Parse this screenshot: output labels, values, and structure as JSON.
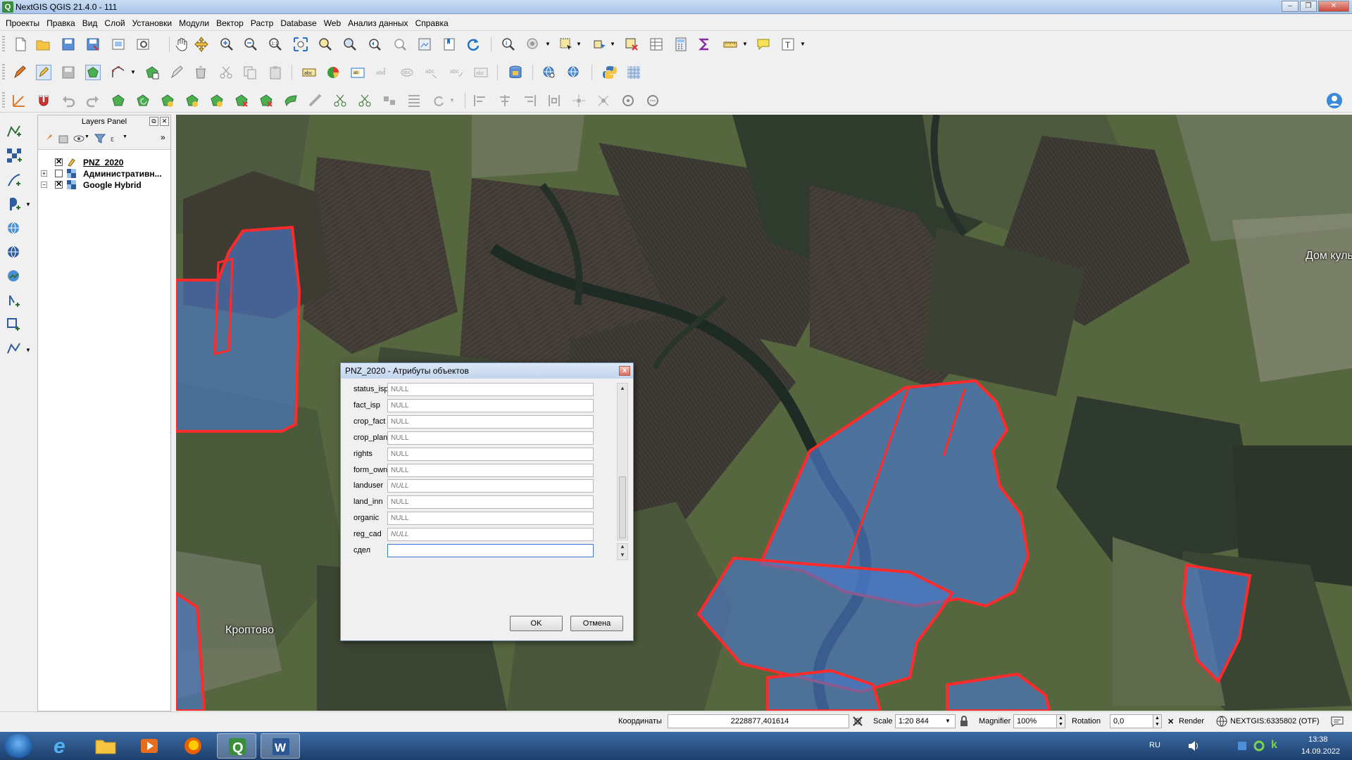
{
  "window": {
    "title": "NextGIS QGIS 21.4.0 - 111",
    "app_icon_letter": "Q"
  },
  "menu": [
    "Проекты",
    "Правка",
    "Вид",
    "Слой",
    "Установки",
    "Модули",
    "Вектор",
    "Растр",
    "Database",
    "Web",
    "Анализ данных",
    "Справка"
  ],
  "layers_panel": {
    "title": "Layers Panel",
    "layers": [
      {
        "name": "PNZ_2020",
        "checked": true
      },
      {
        "name": "Административн...",
        "checked": false
      },
      {
        "name": "Google Hybrid",
        "checked": true
      }
    ]
  },
  "map": {
    "labels": [
      "Кроптово",
      "Дом куль"
    ]
  },
  "dialog": {
    "title": "PNZ_2020 - Атрибуты объектов",
    "close_glyph": "x",
    "fields": [
      {
        "label": "status_isp",
        "placeholder": "NULL"
      },
      {
        "label": "fact_isp",
        "placeholder": "NULL"
      },
      {
        "label": "crop_fact",
        "placeholder": "NULL"
      },
      {
        "label": "crop_plan",
        "placeholder": "NULL"
      },
      {
        "label": "rights",
        "placeholder": "NULL"
      },
      {
        "label": "form_own",
        "placeholder": "NULL"
      },
      {
        "label": "landuser",
        "placeholder": "NULL"
      },
      {
        "label": "land_inn",
        "placeholder": "NULL"
      },
      {
        "label": "organic",
        "placeholder": "NULL"
      },
      {
        "label": "reg_cad",
        "placeholder": "NULL"
      },
      {
        "label": "сдел",
        "placeholder": ""
      }
    ],
    "ok_label": "OK",
    "cancel_label": "Отмена"
  },
  "statusbar": {
    "coord_label": "Координаты",
    "coord_value": "2228877,401614",
    "scale_label": "Scale",
    "scale_value": "1:20 844",
    "magnifier_label": "Magnifier",
    "magnifier_value": "100%",
    "rotation_label": "Rotation",
    "rotation_value": "0,0",
    "render_label": "Render",
    "crs_label": "NEXTGIS:6335802 (OTF)"
  },
  "taskbar": {
    "language": "RU",
    "time": "13:38",
    "date": "14.09.2022"
  },
  "colors": {
    "selection_red": "#ff2a2a",
    "polygon_fill": "#4a78c8",
    "accent_blue": "#3d7bd8"
  }
}
